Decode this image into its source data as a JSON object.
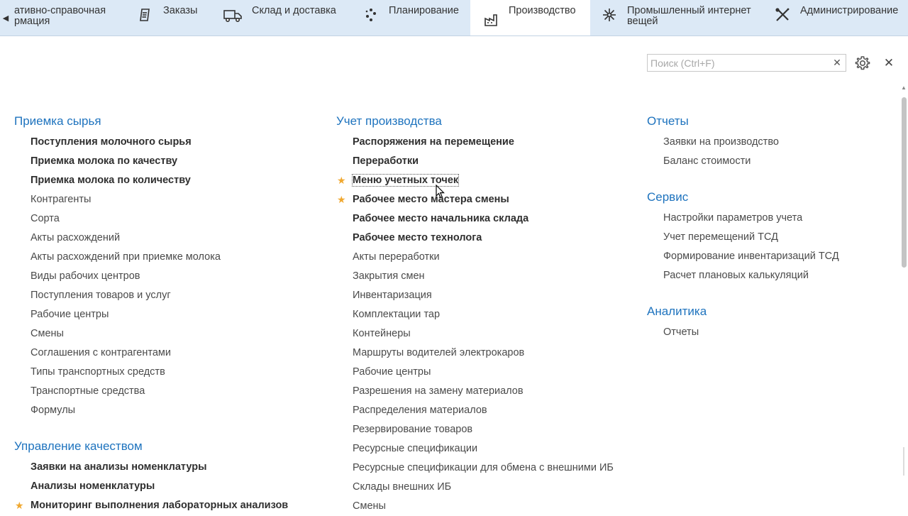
{
  "sections": [
    {
      "label": "ативно-справочная\nрмация",
      "icon": "none"
    },
    {
      "label": "Заказы",
      "icon": "orders-icon"
    },
    {
      "label": "Склад и доставка",
      "icon": "truck-icon"
    },
    {
      "label": "Планирование",
      "icon": "planning-icon"
    },
    {
      "label": "Производство",
      "icon": "factory-icon"
    },
    {
      "label": "Промышленный интернет\nвещей",
      "icon": "iot-icon"
    },
    {
      "label": "Администрирование",
      "icon": "admin-tools-icon"
    }
  ],
  "active_section": "Производство",
  "search": {
    "placeholder": "Поиск (Ctrl+F)",
    "value": ""
  },
  "columns": {
    "left": [
      {
        "title": "Приемка сырья",
        "items": [
          {
            "label": "Поступления молочного сырья",
            "bold": true
          },
          {
            "label": "Приемка молока по качеству",
            "bold": true
          },
          {
            "label": "Приемка молока по количеству",
            "bold": true
          },
          {
            "label": "Контрагенты"
          },
          {
            "label": "Сорта"
          },
          {
            "label": "Акты расхождений"
          },
          {
            "label": "Акты расхождений при приемке молока"
          },
          {
            "label": "Виды рабочих центров"
          },
          {
            "label": "Поступления товаров и услуг"
          },
          {
            "label": "Рабочие центры"
          },
          {
            "label": "Смены"
          },
          {
            "label": "Соглашения с контрагентами"
          },
          {
            "label": "Типы транспортных средств"
          },
          {
            "label": "Транспортные средства"
          },
          {
            "label": "Формулы"
          }
        ]
      },
      {
        "title": "Управление качеством",
        "items": [
          {
            "label": "Заявки на анализы номенклатуры",
            "bold": true
          },
          {
            "label": "Анализы номенклатуры",
            "bold": true
          },
          {
            "label": "Мониторинг выполнения лабораторных анализов",
            "bold": true,
            "star": true
          }
        ]
      }
    ],
    "middle": [
      {
        "title": "Учет производства",
        "items": [
          {
            "label": "Распоряжения на перемещение",
            "bold": true
          },
          {
            "label": "Переработки",
            "bold": true
          },
          {
            "label": "Меню учетных точек",
            "bold": true,
            "star": true,
            "focused": true
          },
          {
            "label": "Рабочее место мастера смены",
            "bold": true,
            "star": true
          },
          {
            "label": "Рабочее место начальника склада",
            "bold": true
          },
          {
            "label": "Рабочее место технолога",
            "bold": true
          },
          {
            "label": "Акты переработки"
          },
          {
            "label": "Закрытия смен"
          },
          {
            "label": "Инвентаризация"
          },
          {
            "label": "Комплектации тар"
          },
          {
            "label": "Контейнеры"
          },
          {
            "label": "Маршруты водителей электрокаров"
          },
          {
            "label": "Рабочие центры"
          },
          {
            "label": "Разрешения на замену материалов"
          },
          {
            "label": "Распределения материалов"
          },
          {
            "label": "Резервирование товаров"
          },
          {
            "label": "Ресурсные спецификации"
          },
          {
            "label": "Ресурсные спецификации для обмена с внешними ИБ"
          },
          {
            "label": "Склады внешних ИБ"
          },
          {
            "label": "Смены"
          }
        ]
      }
    ],
    "right": [
      {
        "title": "Отчеты",
        "items": [
          {
            "label": "Заявки на производство"
          },
          {
            "label": "Баланс стоимости"
          }
        ]
      },
      {
        "title": "Сервис",
        "items": [
          {
            "label": "Настройки параметров учета"
          },
          {
            "label": "Учет перемещений ТСД"
          },
          {
            "label": "Формирование инвентаризаций ТСД"
          },
          {
            "label": "Расчет плановых калькуляций"
          }
        ]
      },
      {
        "title": "Аналитика",
        "items": [
          {
            "label": "Отчеты"
          }
        ]
      }
    ]
  },
  "colors": {
    "topbar_bg": "#dce9f6",
    "group_title": "#1e73be",
    "favorite_star": "#f0a830"
  }
}
